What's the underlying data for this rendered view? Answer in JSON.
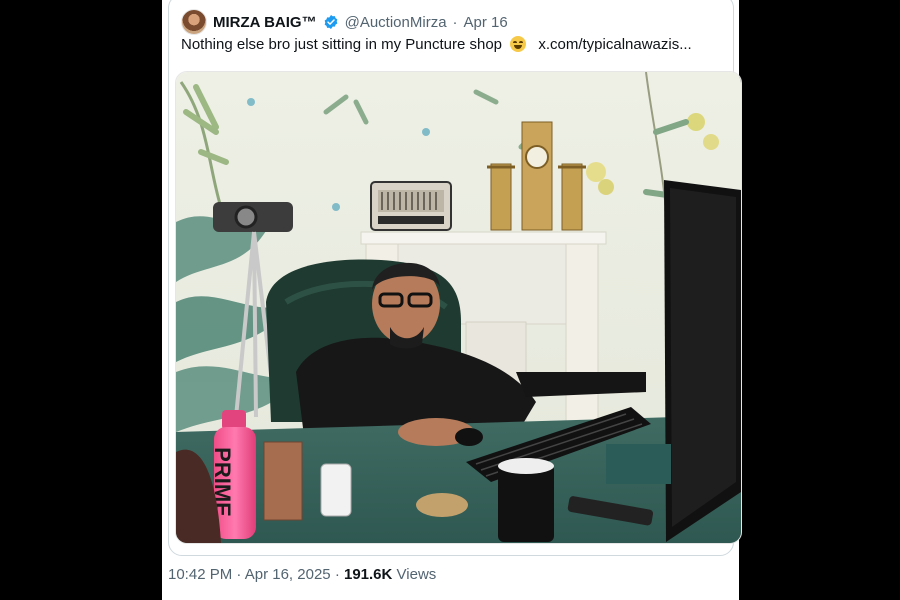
{
  "tweet": {
    "author_name": "MIRZA BAIG™",
    "handle": "@AuctionMirza",
    "separator": "·",
    "date": "Apr 16",
    "text": "Nothing else bro just sitting in my Puncture shop",
    "link": "x.com/typicalnawazis...",
    "emoji": "face-with-tears-of-joy-icon",
    "verified_color": "#1d9bf0"
  },
  "media": {
    "bottle_brand": "PRIME"
  },
  "footer": {
    "time": "10:42 PM",
    "sep1": "·",
    "date": "Apr 16, 2025",
    "sep2": "·",
    "views_count": "191.6K",
    "views_label": "Views"
  }
}
